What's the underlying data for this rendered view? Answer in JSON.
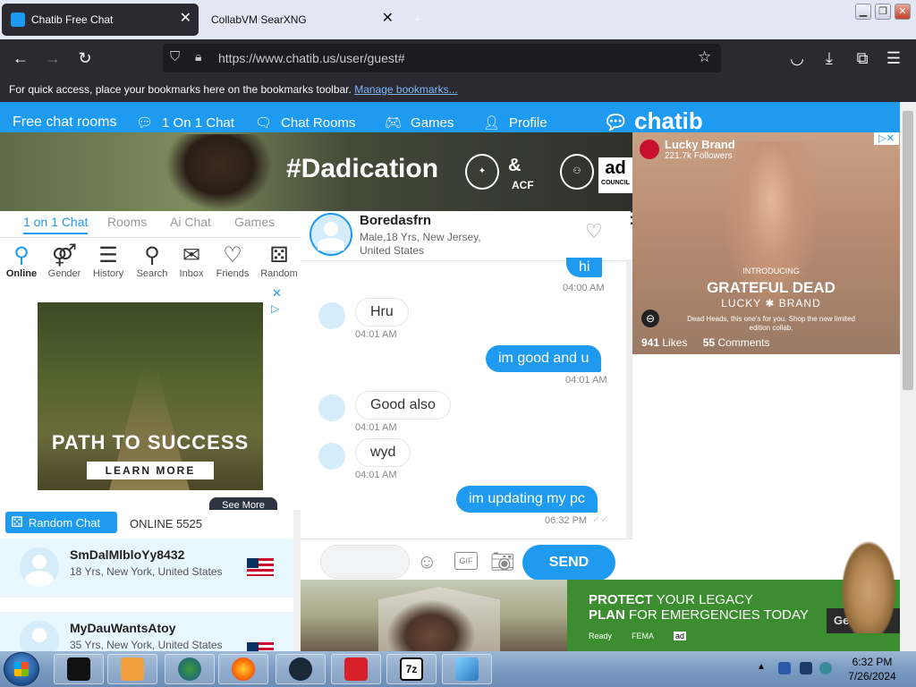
{
  "browser": {
    "tabs": [
      {
        "title": "Chatib Free Chat",
        "active": true
      },
      {
        "title": "CollabVM SearXNG",
        "active": false
      }
    ],
    "url": "https://www.chatib.us/user/guest#",
    "bookmarks_message": "For quick access, place your bookmarks here on the bookmarks toolbar.",
    "bookmarks_link": "Manage bookmarks..."
  },
  "site": {
    "logo": "chatib",
    "nav": [
      {
        "label": "Free chat rooms",
        "icon": "none"
      },
      {
        "label": "1 On 1 Chat",
        "icon": "chat-bubble-icon"
      },
      {
        "label": "Chat Rooms",
        "icon": "chat-bubbles-icon"
      },
      {
        "label": "Games",
        "icon": "gamepad-icon"
      },
      {
        "label": "Profile",
        "icon": "user-icon"
      }
    ]
  },
  "banner": {
    "hashtag": "#Dadication",
    "acf_label": "ACF",
    "ad_label": "ad",
    "council_label": "COUNCIL"
  },
  "left_panel": {
    "tabs": [
      "1 on 1 Chat",
      "Rooms",
      "Ai Chat",
      "Games"
    ],
    "tools": [
      {
        "label": "Online",
        "icon": "online-user-icon"
      },
      {
        "label": "Gender",
        "icon": "gender-icon"
      },
      {
        "label": "History",
        "icon": "history-list-icon"
      },
      {
        "label": "Search",
        "icon": "search-icon"
      },
      {
        "label": "Inbox",
        "icon": "inbox-icon"
      },
      {
        "label": "Friends",
        "icon": "heart-icon"
      },
      {
        "label": "Random",
        "icon": "dice-icon"
      }
    ],
    "ad": {
      "title": "PATH TO SUCCESS",
      "button": "LEARN MORE",
      "see_more": "See More"
    },
    "random_chat_label": "Random Chat",
    "online_count": "ONLINE 5525",
    "users": [
      {
        "name": "SmDalMlbloYy8432",
        "info": "18 Yrs, New York, United States"
      },
      {
        "name": "MyDauWantsAtoy",
        "info": "35 Yrs, New York, United States"
      }
    ]
  },
  "chat": {
    "partner_name": "Boredasfrn",
    "partner_info": "Male,18 Yrs, New Jersey, United States",
    "messages": [
      {
        "side": "sent",
        "text": "hi",
        "time": "04:00 AM"
      },
      {
        "side": "recv",
        "text": "Hru",
        "time": "04:01 AM"
      },
      {
        "side": "sent",
        "text": "im good and u",
        "time": "04:01 AM"
      },
      {
        "side": "recv",
        "text": "Good also",
        "time": "04:01 AM"
      },
      {
        "side": "recv",
        "text": "wyd",
        "time": "04:01 AM"
      },
      {
        "side": "sent",
        "text": "im updating my pc",
        "time": "06:32 PM"
      }
    ],
    "gif_label": "GIF",
    "send_label": "SEND"
  },
  "right_ad": {
    "brand": "Lucky Brand",
    "followers": "221.7k Followers",
    "intro": "INTRODUCING",
    "headline": "GRATEFUL DEAD",
    "subhead": "LUCKY ✱ BRAND",
    "caption": "Dead Heads, this one's for you. Shop the new limited edition collab.",
    "likes_count": "941",
    "likes_label": "Likes",
    "comments_count": "55",
    "comments_label": "Comments"
  },
  "bottom_ad": {
    "line1_bold": "PROTECT",
    "line1_rest": " YOUR LEGACY",
    "line2_bold": "PLAN",
    "line2_rest": " FOR EMERGENCIES TODAY",
    "logos": [
      "Ready",
      "FEMA",
      "ad"
    ],
    "button": "Get ed"
  },
  "taskbar": {
    "time": "6:32 PM",
    "date": "7/26/2024",
    "apps": [
      "cmd-icon",
      "media-player-icon",
      "network-globe-icon",
      "firefox-icon",
      "steam-icon",
      "avira-icon",
      "7zip-icon",
      "app-icon"
    ],
    "sevenzip_label": "7z"
  },
  "colors": {
    "accent": "#1e9af0",
    "chrome_dark": "#2b2a33",
    "ad_green": "#3c8d2f"
  }
}
